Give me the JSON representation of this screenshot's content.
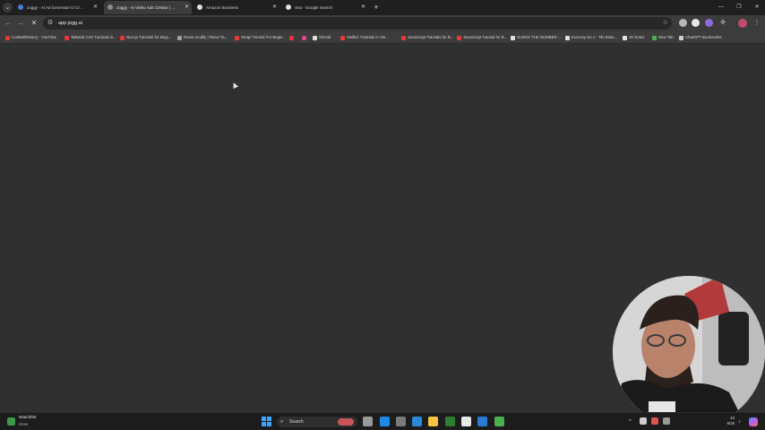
{
  "browser": {
    "tab_search_icon": "chevron-down-icon",
    "tabs": [
      {
        "title": "Joggy - AI Ad Generator to Create Vi",
        "favicon_color": "#4a7bd8",
        "active": false
      },
      {
        "title": "Joggy - AI Video Ads Creator | Fast &",
        "favicon_color": "#8a8a8a",
        "active": true
      },
      {
        "title": "Amazon Business",
        "favicon_color": "#e0e0e0",
        "active": false
      },
      {
        "title": "visa - Google Search",
        "favicon_color": "#e0e0e0",
        "active": false
      }
    ],
    "new_tab_icon": "plus-icon",
    "window_controls": [
      "minimize-icon",
      "maximize-icon",
      "close-icon"
    ]
  },
  "toolbar": {
    "back_icon": "arrow-left-icon",
    "forward_icon": "arrow-right-icon",
    "reload_icon": "close-icon",
    "site_info_icon": "tune-icon",
    "url": "app.jogg.ai",
    "bookmark_icon": "star-icon",
    "extension_colors": [
      "#b8b8b8",
      "#e8e8e8",
      "#8c6bd8"
    ],
    "puzzle_icon": "puzzle-icon",
    "profile_color": "#c24a6b",
    "menu_icon": "more-vert-icon"
  },
  "bookmarks": [
    {
      "label": "CodeWithHarry - YouTube",
      "color": "#e53935"
    },
    {
      "label": "Tailwind CSS Tutorials in...",
      "color": "#e53935"
    },
    {
      "label": "Next.js Tutorials for Begi...",
      "color": "#e53935"
    },
    {
      "label": "React-modify | React Ta...",
      "color": "#9e9e9e"
    },
    {
      "label": "Strapi Tutorial For Begin...",
      "color": "#e53935"
    },
    {
      "label": "",
      "color": "#e53935"
    },
    {
      "label": "",
      "color": "#d2478c"
    },
    {
      "label": "GitHub",
      "color": "#e0e0e0"
    },
    {
      "label": "SwiftUI Tutorials in Hin...",
      "color": "#e53935"
    },
    {
      "label": "JavaScript Tutorials for B...",
      "color": "#e53935"
    },
    {
      "label": "JavaScript Tutorial for B...",
      "color": "#e53935"
    },
    {
      "label": "GUESS THE NUMBER -...",
      "color": "#e0e0e0"
    },
    {
      "label": "Excessy No 1 - Tils Bebe...",
      "color": "#e0e0e0"
    },
    {
      "label": "JS Notes",
      "color": "#e0e0e0"
    },
    {
      "label": "New Tab",
      "color": "#4caf50"
    },
    {
      "label": "ChatGPT Bookmarks",
      "color": "#cfcfcf",
      "folder": true
    }
  ],
  "taskbar": {
    "weather": {
      "title": "Watchlist",
      "subtitle": "Ideas"
    },
    "search_label": "Search",
    "app_colors": [
      "#9a9a9a",
      "#1e88e5",
      "#7a7a7a",
      "#2b88d8",
      "#f6c343",
      "#2e7d32",
      "#e8e8e8",
      "#2b7bd6",
      "#4caf50"
    ],
    "tray_colors": [
      "#cfcfcf",
      "#d9534f",
      "#9a9a9a"
    ],
    "clock": {
      "time": "10",
      "date": "6/26"
    }
  }
}
